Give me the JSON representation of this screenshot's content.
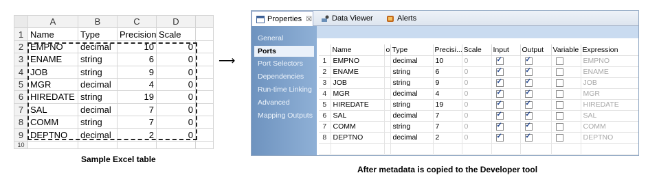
{
  "excel": {
    "col_headers": [
      "A",
      "B",
      "C",
      "D"
    ],
    "rows": [
      [
        "Name",
        "Type",
        "Precision",
        "Scale"
      ],
      [
        "EMPNO",
        "decimal",
        "10",
        "0"
      ],
      [
        "ENAME",
        "string",
        "6",
        "0"
      ],
      [
        "JOB",
        "string",
        "9",
        "0"
      ],
      [
        "MGR",
        "decimal",
        "4",
        "0"
      ],
      [
        "HIREDATE",
        "string",
        "19",
        "0"
      ],
      [
        "SAL",
        "decimal",
        "7",
        "0"
      ],
      [
        "COMM",
        "string",
        "7",
        "0"
      ],
      [
        "DEPTNO",
        "decimal",
        "2",
        "0"
      ]
    ],
    "last_row_number": "10",
    "caption": "Sample Excel table"
  },
  "arrow": "⟶",
  "tabs": [
    {
      "label": "Properties",
      "close": "☒"
    },
    {
      "label": "Data Viewer"
    },
    {
      "label": "Alerts"
    }
  ],
  "nav": [
    "General",
    "Ports",
    "Port Selectors",
    "Dependencies",
    "Run-time Linking",
    "Advanced",
    "Mapping Outputs"
  ],
  "grid": {
    "headers": [
      "Name",
      "o",
      "Type",
      "Precisi...",
      "Scale",
      "Input",
      "Output",
      "Variable",
      "Expression"
    ],
    "rows": [
      {
        "name": "EMPNO",
        "type": "decimal",
        "precision": "10",
        "scale": "0",
        "input": true,
        "output": true,
        "variable": false,
        "expression": "EMPNO"
      },
      {
        "name": "ENAME",
        "type": "string",
        "precision": "6",
        "scale": "0",
        "input": true,
        "output": true,
        "variable": false,
        "expression": "ENAME"
      },
      {
        "name": "JOB",
        "type": "string",
        "precision": "9",
        "scale": "0",
        "input": true,
        "output": true,
        "variable": false,
        "expression": "JOB"
      },
      {
        "name": "MGR",
        "type": "decimal",
        "precision": "4",
        "scale": "0",
        "input": true,
        "output": true,
        "variable": false,
        "expression": "MGR"
      },
      {
        "name": "HIREDATE",
        "type": "string",
        "precision": "19",
        "scale": "0",
        "input": true,
        "output": true,
        "variable": false,
        "expression": "HIREDATE"
      },
      {
        "name": "SAL",
        "type": "decimal",
        "precision": "7",
        "scale": "0",
        "input": true,
        "output": true,
        "variable": false,
        "expression": "SAL"
      },
      {
        "name": "COMM",
        "type": "string",
        "precision": "7",
        "scale": "0",
        "input": true,
        "output": true,
        "variable": false,
        "expression": "COMM"
      },
      {
        "name": "DEPTNO",
        "type": "decimal",
        "precision": "2",
        "scale": "0",
        "input": true,
        "output": true,
        "variable": false,
        "expression": "DEPTNO"
      }
    ]
  },
  "caption2": "After metadata is copied to the Developer tool"
}
